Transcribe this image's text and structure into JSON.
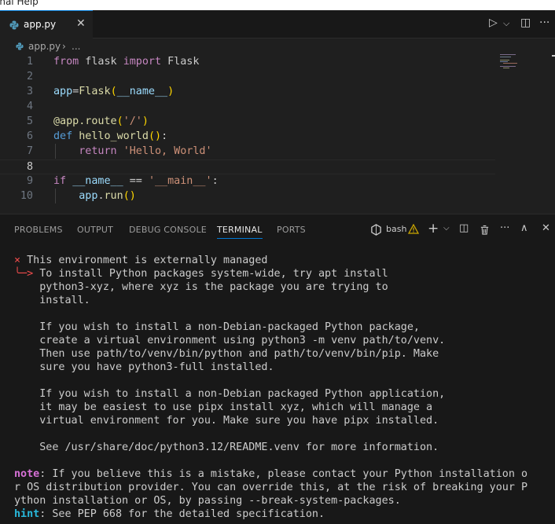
{
  "menubar": {
    "partial_text": "inal   Help"
  },
  "tab": {
    "label": "app.py",
    "close": "✕"
  },
  "tab_actions": {
    "run": "▷",
    "run_menu": "⌵",
    "split": "◫",
    "more": "···"
  },
  "breadcrumb": {
    "file": "app.py",
    "sep": "›",
    "more": "..."
  },
  "editor": {
    "lines": [
      {
        "n": "1",
        "tokens": [
          [
            "kw-purple",
            "from"
          ],
          [
            "cls",
            " flask "
          ],
          [
            "kw-purple",
            "import"
          ],
          [
            "cls",
            " Flask"
          ]
        ]
      },
      {
        "n": "2",
        "tokens": []
      },
      {
        "n": "3",
        "tokens": [
          [
            "var",
            "app"
          ],
          [
            "cls",
            "="
          ],
          [
            "fn",
            "Flask"
          ],
          [
            "brk1",
            "("
          ],
          [
            "var",
            "__name__"
          ],
          [
            "brk1",
            ")"
          ]
        ]
      },
      {
        "n": "4",
        "tokens": []
      },
      {
        "n": "5",
        "tokens": [
          [
            "fn",
            "@app.route"
          ],
          [
            "brk1",
            "("
          ],
          [
            "str",
            "'/'"
          ],
          [
            "brk1",
            ")"
          ]
        ]
      },
      {
        "n": "6",
        "tokens": [
          [
            "kw-blue",
            "def"
          ],
          [
            "cls",
            " "
          ],
          [
            "fn",
            "hello_world"
          ],
          [
            "brk1",
            "()"
          ],
          [
            "cls",
            ":"
          ]
        ]
      },
      {
        "n": "7",
        "tokens": [
          [
            "cls",
            "    "
          ],
          [
            "kw-purple",
            "return"
          ],
          [
            "cls",
            " "
          ],
          [
            "str",
            "'Hello, World'"
          ]
        ]
      },
      {
        "n": "8",
        "tokens": []
      },
      {
        "n": "9",
        "tokens": [
          [
            "kw-purple",
            "if"
          ],
          [
            "cls",
            " "
          ],
          [
            "var",
            "__name__"
          ],
          [
            "cls",
            " == "
          ],
          [
            "str",
            "'__main__'"
          ],
          [
            "cls",
            ":"
          ]
        ]
      },
      {
        "n": "10",
        "tokens": [
          [
            "cls",
            "    "
          ],
          [
            "var",
            "app"
          ],
          [
            "cls",
            "."
          ],
          [
            "fn",
            "run"
          ],
          [
            "brk1",
            "()"
          ]
        ]
      }
    ]
  },
  "panel": {
    "tabs": [
      "PROBLEMS",
      "OUTPUT",
      "DEBUG CONSOLE",
      "TERMINAL",
      "PORTS"
    ],
    "active_tab": "TERMINAL",
    "shell": "bash",
    "actions": {
      "add": "+",
      "add_menu": "⌵",
      "split": "◫",
      "trash": "🗑",
      "more": "···",
      "maximize": "∧",
      "close": "✕"
    }
  },
  "terminal": {
    "lines": [
      [
        [
          "red",
          "× "
        ],
        [
          "",
          "This environment is externally managed"
        ]
      ],
      [
        [
          "red",
          "╰─> "
        ],
        [
          "",
          "To install Python packages system-wide, try apt install"
        ]
      ],
      [
        [
          "",
          "    python3-xyz, where xyz is the package you are trying to"
        ]
      ],
      [
        [
          "",
          "    install."
        ]
      ],
      [
        [
          "",
          ""
        ]
      ],
      [
        [
          "",
          "    If you wish to install a non-Debian-packaged Python package,"
        ]
      ],
      [
        [
          "",
          "    create a virtual environment using python3 -m venv path/to/venv."
        ]
      ],
      [
        [
          "",
          "    Then use path/to/venv/bin/python and path/to/venv/bin/pip. Make"
        ]
      ],
      [
        [
          "",
          "    sure you have python3-full installed."
        ]
      ],
      [
        [
          "",
          ""
        ]
      ],
      [
        [
          "",
          "    If you wish to install a non-Debian packaged Python application,"
        ]
      ],
      [
        [
          "",
          "    it may be easiest to use pipx install xyz, which will manage a"
        ]
      ],
      [
        [
          "",
          "    virtual environment for you. Make sure you have pipx installed."
        ]
      ],
      [
        [
          "",
          ""
        ]
      ],
      [
        [
          "",
          "    See /usr/share/doc/python3.12/README.venv for more information."
        ]
      ],
      [
        [
          "",
          ""
        ]
      ],
      [
        [
          "magenta",
          "note"
        ],
        [
          "",
          ": If you believe this is a mistake, please contact your Python installation o"
        ]
      ],
      [
        [
          "",
          "r OS distribution provider. You can override this, at the risk of breaking your P"
        ]
      ],
      [
        [
          "",
          "ython installation or OS, by passing --break-system-packages."
        ]
      ],
      [
        [
          "cyan",
          "hint"
        ],
        [
          "",
          ": See PEP 668 for the detailed specification."
        ]
      ]
    ]
  },
  "colors": {
    "accent": "#0078d4",
    "editor_bg": "#1f1f1f",
    "panel_bg": "#181818",
    "warning": "#cca700"
  }
}
